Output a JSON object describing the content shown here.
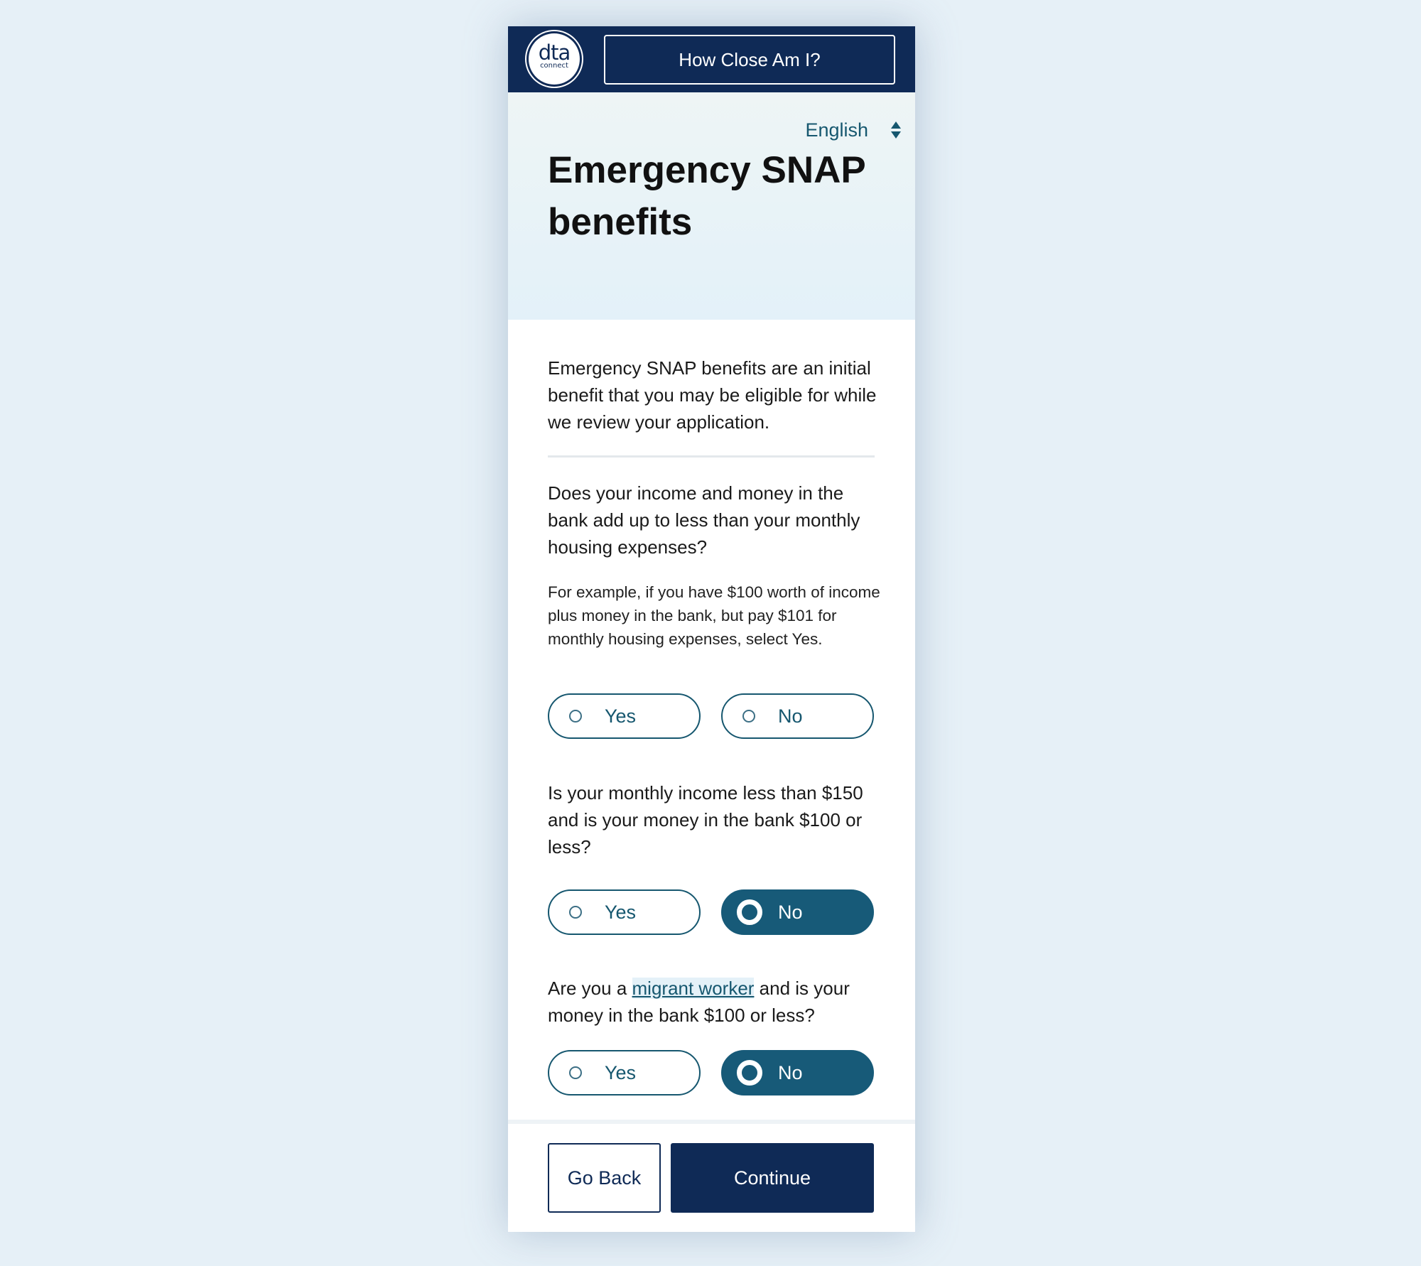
{
  "header": {
    "logo_text": "dta",
    "logo_subtext": "connect",
    "how_close_label": "How Close Am I?"
  },
  "hero": {
    "language": "English",
    "title": "Emergency SNAP benefits"
  },
  "intro": "Emergency SNAP benefits are an initial benefit that you may be eligible for while we review your application.",
  "questions": [
    {
      "text": "Does your income and money in the bank add up to less than your monthly housing expenses?",
      "help": "For example, if you have $100 worth of income plus money in the bank, but pay $101 for monthly housing expenses, select Yes.",
      "options": [
        "Yes",
        "No"
      ],
      "selected": null
    },
    {
      "text": "Is your monthly income less than $150 and is your money in the bank $100 or less?",
      "options": [
        "Yes",
        "No"
      ],
      "selected": "No"
    },
    {
      "text_before": "Are you a ",
      "link": "migrant worker",
      "text_after": " and is your money in the bank $100 or less?",
      "options": [
        "Yes",
        "No"
      ],
      "selected": "No"
    }
  ],
  "footer": {
    "back_label": "Go Back",
    "continue_label": "Continue"
  },
  "colors": {
    "navy": "#0f2a56",
    "teal": "#16576f",
    "selected_fill": "#175a78",
    "page_background": "#e6f0f7"
  }
}
